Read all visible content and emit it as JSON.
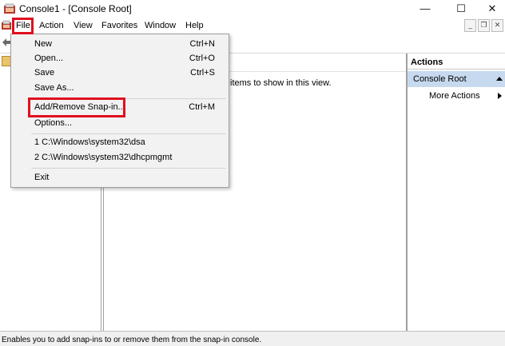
{
  "window": {
    "title": "Console1 - [Console Root]",
    "controls": {
      "minimize": "—",
      "maximize": "☐",
      "close": "✕"
    }
  },
  "menubar": {
    "items": [
      "File",
      "Action",
      "View",
      "Favorites",
      "Window",
      "Help"
    ]
  },
  "mdi_controls": {
    "minimize": "_",
    "restore": "❐",
    "close": "✕"
  },
  "result_pane": {
    "message": "items to show in this view."
  },
  "actions_pane": {
    "title": "Actions",
    "section": "Console Root",
    "more_actions": "More Actions"
  },
  "file_menu": {
    "items": [
      {
        "label": "New",
        "shortcut": "Ctrl+N"
      },
      {
        "label": "Open...",
        "shortcut": "Ctrl+O"
      },
      {
        "label": "Save",
        "shortcut": "Ctrl+S"
      },
      {
        "label": "Save As...",
        "shortcut": ""
      },
      {
        "label": "Add/Remove Snap-in...",
        "shortcut": "Ctrl+M"
      },
      {
        "label": "Options...",
        "shortcut": ""
      },
      {
        "label": "1 C:\\Windows\\system32\\dsa",
        "shortcut": ""
      },
      {
        "label": "2 C:\\Windows\\system32\\dhcpmgmt",
        "shortcut": ""
      },
      {
        "label": "Exit",
        "shortcut": ""
      }
    ]
  },
  "statusbar": {
    "text": "Enables you to add snap-ins to or remove them from the snap-in console."
  },
  "colors": {
    "highlight_box": "#e0101e",
    "actions_selected": "#c7d9ee",
    "menu_bg": "#f2f2f2"
  }
}
